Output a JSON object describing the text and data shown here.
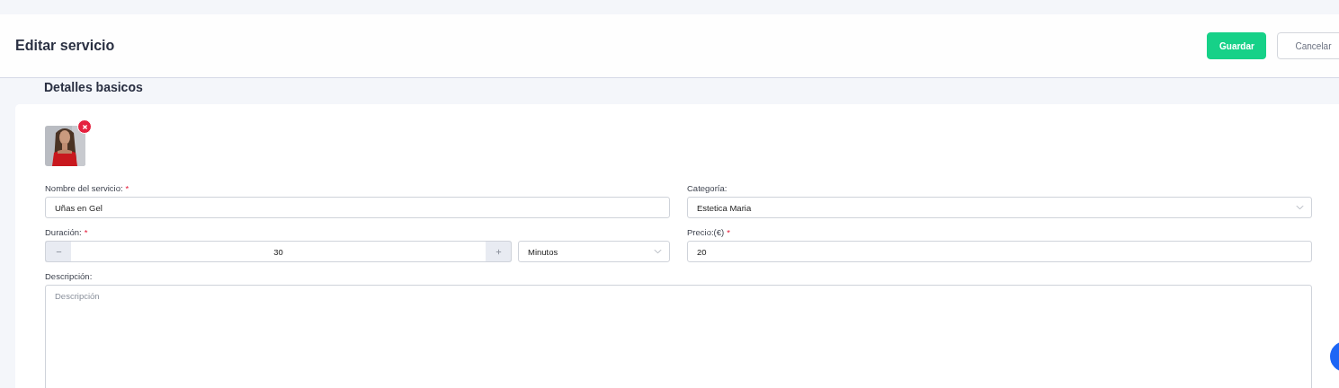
{
  "header": {
    "title": "Editar servicio",
    "buttons": [
      {
        "label": "Guardar",
        "kind": "primary"
      },
      {
        "label": "Cancelar",
        "kind": "secondary"
      }
    ]
  },
  "section_title": "Detalles basicos",
  "image": {
    "kind": "picture",
    "removable": true
  },
  "fields": [
    {
      "kind": "text",
      "label": "Nombre del servicio:",
      "required_mark": "*",
      "value": "Uñas en Gel"
    },
    {
      "kind": "select",
      "label": "Categoría:",
      "value": "Estetica Maria"
    },
    {
      "kind": "stepper",
      "label": "Duración:",
      "required_mark": "*",
      "value": "30",
      "unit": "Minutos"
    },
    {
      "kind": "text",
      "label": "Precio:(€)",
      "required_mark": "*",
      "value": "20"
    },
    {
      "kind": "textarea",
      "label": "Descripción:",
      "placeholder": "Descripción"
    }
  ]
}
